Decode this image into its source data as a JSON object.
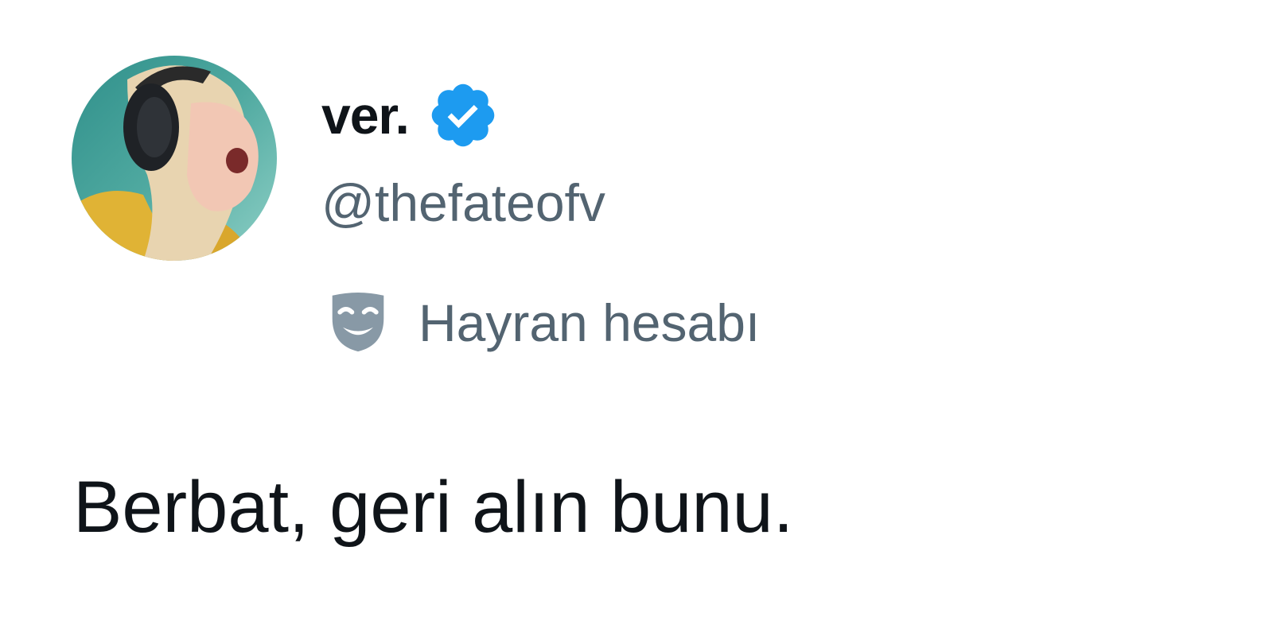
{
  "tweet": {
    "author": {
      "display_name": "ver.",
      "handle": "@thefateofv",
      "verified": true,
      "avatar_icon": "avatar-photo",
      "label": {
        "icon": "theater-mask-icon",
        "text": "Hayran hesabı"
      }
    },
    "text": "Berbat, geri alın bunu."
  },
  "colors": {
    "primary_text": "#0f1419",
    "secondary_text": "#536471",
    "verified_blue": "#1d9bf0",
    "background": "#ffffff"
  }
}
